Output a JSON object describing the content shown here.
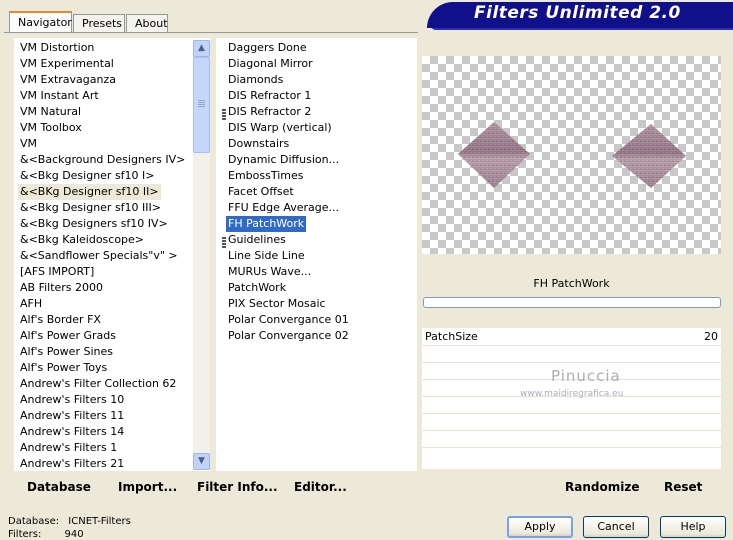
{
  "tabs": [
    "Navigator",
    "Presets",
    "About"
  ],
  "banner_title": "Filters Unlimited 2.0",
  "categories": [
    "VM Distortion",
    "VM Experimental",
    "VM Extravaganza",
    "VM Instant Art",
    "VM Natural",
    "VM Toolbox",
    "VM",
    "&<Background Designers IV>",
    "&<Bkg Designer sf10 I>",
    "&<BKg Designer sf10 II>",
    "&<Bkg Designer sf10 III>",
    "&<Bkg Designers sf10 IV>",
    "&<Bkg Kaleidoscope>",
    "&<Sandflower Specials\"v\" >",
    "[AFS IMPORT]",
    "AB Filters 2000",
    "AFH",
    "Alf's Border FX",
    "Alf's Power Grads",
    "Alf's Power Sines",
    "Alf's Power Toys",
    "Andrew's Filter Collection 62",
    "Andrew's Filters 10",
    "Andrew's Filters 11",
    "Andrew's Filters 14",
    "Andrew's Filters 1",
    "Andrew's Filters 21"
  ],
  "selected_category": "&<BKg Designer sf10 II>",
  "filters": [
    "Daggers Done",
    "Diagonal Mirror",
    "Diamonds",
    "DIS Refractor 1",
    "DIS Refractor 2",
    "DIS Warp (vertical)",
    "Downstairs",
    "Dynamic Diffusion...",
    "EmbossTimes",
    "Facet Offset",
    "FFU Edge Average...",
    "FH PatchWork",
    "Guidelines",
    "Line Side Line",
    "MURUs Wave...",
    "PatchWork",
    "PIX Sector Mosaic",
    "Polar Convergance 01",
    "Polar Convergance 02"
  ],
  "selected_filter": "FH PatchWork",
  "filter_title": "FH PatchWork",
  "param": {
    "name": "PatchSize",
    "value": "20"
  },
  "watermark": {
    "line1": "Pinuccia",
    "line2": "www.maidiregrafica.eu"
  },
  "toolbar": {
    "database": "Database",
    "import": "Import...",
    "filter_info": "Filter Info...",
    "editor": "Editor...",
    "randomize": "Randomize",
    "reset": "Reset"
  },
  "status": {
    "db_label": "Database:",
    "db_value": "ICNET-Filters",
    "filters_label": "Filters:",
    "filters_value": "940"
  },
  "buttons": {
    "apply": "Apply",
    "cancel": "Cancel",
    "help": "Help"
  },
  "colors": {
    "banner": "#10108a",
    "selection": "#316ac5",
    "tab_accent": "#e68b2c"
  }
}
